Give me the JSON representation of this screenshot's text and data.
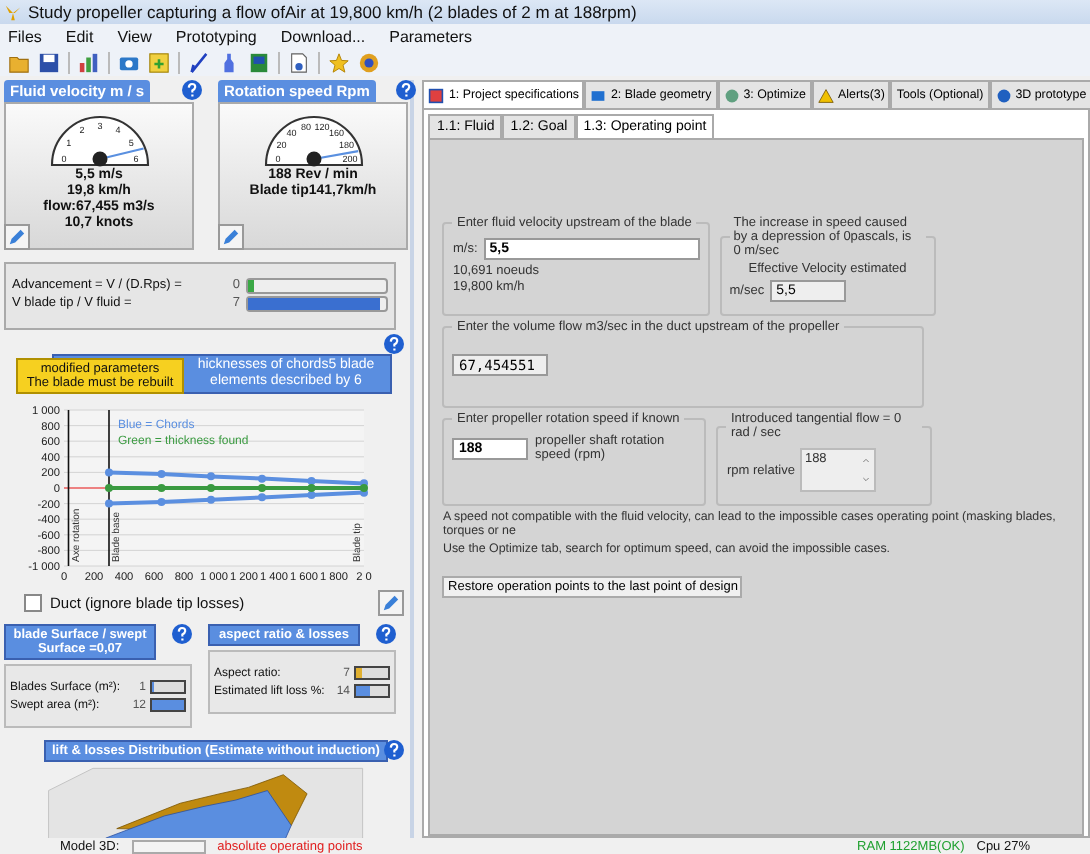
{
  "window": {
    "title": "Study propeller capturing a flow ofAir at 19,800 km/h (2 blades of 2 m at 188rpm)"
  },
  "menu": [
    "Files",
    "Edit",
    "View",
    "Prototyping",
    "Download...",
    "Parameters"
  ],
  "gauges": [
    {
      "title": "Fluid velocity m / s",
      "ticks": [
        "0",
        "1",
        "2",
        "3",
        "4",
        "5",
        "6"
      ],
      "level": 0.92,
      "readings": [
        "5,5 m/s",
        "19,8 km/h",
        "flow:67,455 m3/s",
        "10,7 knots"
      ]
    },
    {
      "title": "Rotation speed Rpm",
      "ticks": [
        "0",
        "20",
        "40",
        "80",
        "120",
        "160",
        "180",
        "200"
      ],
      "level": 0.94,
      "readings": [
        "188 Rev / min",
        "Blade tip141,7km/h"
      ]
    }
  ],
  "ratios": [
    {
      "label": "Advancement = V / (D.Rps) =",
      "value": "0",
      "level": 0.05,
      "color": "#3aa845"
    },
    {
      "label": "V blade tip / V fluid =",
      "value": "7",
      "level": 0.95,
      "color": "#3a6fd0"
    }
  ],
  "chord_chart": {
    "tooltip": [
      "modified parameters",
      "The blade must be rebuilt"
    ],
    "markers": [
      "Axe rotation",
      "Blade base",
      "Blade tip"
    ],
    "chart_data": {
      "type": "line",
      "grid": true,
      "title": "hicknesses of chords5 blade elements described by 6",
      "x": [
        300,
        650,
        980,
        1320,
        1650,
        2000
      ],
      "series": [
        {
          "name": "Blue = Chords",
          "color": "#5b8fe0",
          "marker": true,
          "values": [
            200,
            180,
            150,
            120,
            90,
            60
          ]
        },
        {
          "color": "#5b8fe0",
          "marker": true,
          "values": [
            -200,
            -180,
            -150,
            -120,
            -90,
            -60
          ]
        },
        {
          "name": "Green = thickness found",
          "color": "#3a9a40",
          "marker": true,
          "values": [
            0,
            0,
            0,
            0,
            0,
            0
          ]
        }
      ],
      "ref_lines": [
        {
          "axis": "x",
          "value": 300
        }
      ],
      "xlim": [
        0,
        2000
      ],
      "ylim": [
        -1000,
        1000
      ],
      "xticks": [
        0,
        200,
        400,
        600,
        800,
        {
          "value": 1000,
          "label": "1 000"
        },
        {
          "value": 1200,
          "label": "1 200"
        },
        {
          "value": 1400,
          "label": "1 400"
        },
        {
          "value": 1600,
          "label": "1 600"
        },
        {
          "value": 1800,
          "label": "1 800"
        },
        {
          "value": 2000,
          "label": "2 0"
        }
      ],
      "yticks": [
        {
          "value": 1000,
          "label": "1 000"
        },
        800,
        600,
        400,
        200,
        0,
        -200,
        -400,
        -600,
        -800,
        {
          "value": -1000,
          "label": "-1 000"
        }
      ]
    }
  },
  "duct": {
    "label": "Duct (ignore blade tip losses)",
    "checked": false
  },
  "surface_panel": {
    "title": "blade Surface /  swept Surface =0,07",
    "rows": [
      {
        "label": "Blades Surface (m²):",
        "value": "1",
        "level": 0.05
      },
      {
        "label": "Swept area (m²):",
        "value": "12",
        "level": 1.0
      }
    ]
  },
  "aspect_panel": {
    "title": "aspect ratio & losses",
    "rows": [
      {
        "label": "Aspect ratio:",
        "value": "7",
        "level": 0.2
      },
      {
        "label": "Estimated  lift loss %:",
        "value": "14",
        "level": 0.45
      }
    ]
  },
  "lift_panel": {
    "title": "lift & losses Distribution (Estimate without induction)"
  },
  "tabs": [
    {
      "label": "1: Project specifications",
      "selected": true
    },
    {
      "label": "2: Blade geometry",
      "selected": false
    },
    {
      "label": "3: Optimize",
      "selected": false
    },
    {
      "label": "Alerts(3)",
      "selected": false
    },
    {
      "label": "Tools (Optional)",
      "selected": false
    },
    {
      "label": "3D prototype",
      "selected": false
    }
  ],
  "subtabs": [
    {
      "label": "1.1: Fluid",
      "selected": false
    },
    {
      "label": "1.2: Goal",
      "selected": false
    },
    {
      "label": "1.3: Operating point",
      "selected": true
    }
  ],
  "velocity_group": {
    "legend": "Enter fluid velocity  upstream of the blade",
    "unit": "m/s:",
    "value": "5,5",
    "notes": [
      "10,691 noeuds",
      "19,800 km/h"
    ]
  },
  "increase_group": {
    "text": "The increase in speed caused by a depression of 0pascals, is 0 m/sec",
    "effective_label": "Effective Velocity estimated",
    "unit": "m/sec",
    "value": "5,5"
  },
  "volume_group": {
    "legend": "Enter the volume flow m3/sec in the duct upstream of the propeller",
    "value": "67,454551"
  },
  "rotation_group": {
    "legend": "Enter propeller rotation speed if known",
    "value": "188",
    "label": "propeller shaft rotation speed (rpm)"
  },
  "tangential_group": {
    "legend": "Introduced tangential flow = 0 rad / sec",
    "label": "rpm relative",
    "value": "188"
  },
  "warning": [
    "A speed not compatible with the fluid velocity, can lead to the impossible cases operating point (masking blades, torques or ne",
    "Use the Optimize tab, search for optimum speed, can avoid the impossible cases."
  ],
  "restore_button": "Restore operation points to the last point of design",
  "status": {
    "model_label": "Model 3D:",
    "operating": "absolute operating points",
    "ram": "RAM 1122MB(OK)",
    "cpu": "Cpu 27%"
  }
}
